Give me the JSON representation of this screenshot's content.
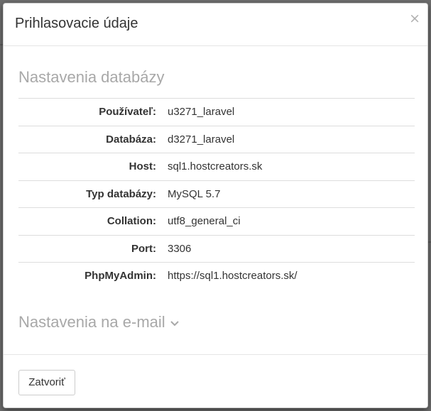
{
  "modal": {
    "title": "Prihlasovacie údaje",
    "close_icon": "×"
  },
  "database_section": {
    "heading": "Nastavenia databázy",
    "rows": [
      {
        "label": "Používateľ:",
        "value": "u3271_laravel"
      },
      {
        "label": "Databáza:",
        "value": "d3271_laravel"
      },
      {
        "label": "Host:",
        "value": "sql1.hostcreators.sk"
      },
      {
        "label": "Typ databázy:",
        "value": "MySQL 5.7"
      },
      {
        "label": "Collation:",
        "value": "utf8_general_ci"
      },
      {
        "label": "Port:",
        "value": "3306"
      },
      {
        "label": "PhpMyAdmin:",
        "value": "https://sql1.hostcreators.sk/"
      }
    ]
  },
  "email_section": {
    "heading": "Nastavenia na e-mail",
    "icon": "chevron-down-icon"
  },
  "footer": {
    "close_label": "Zatvoriť"
  },
  "colors": {
    "muted_heading": "#a8a8a8",
    "text": "#333333",
    "divider": "#dddddd"
  }
}
